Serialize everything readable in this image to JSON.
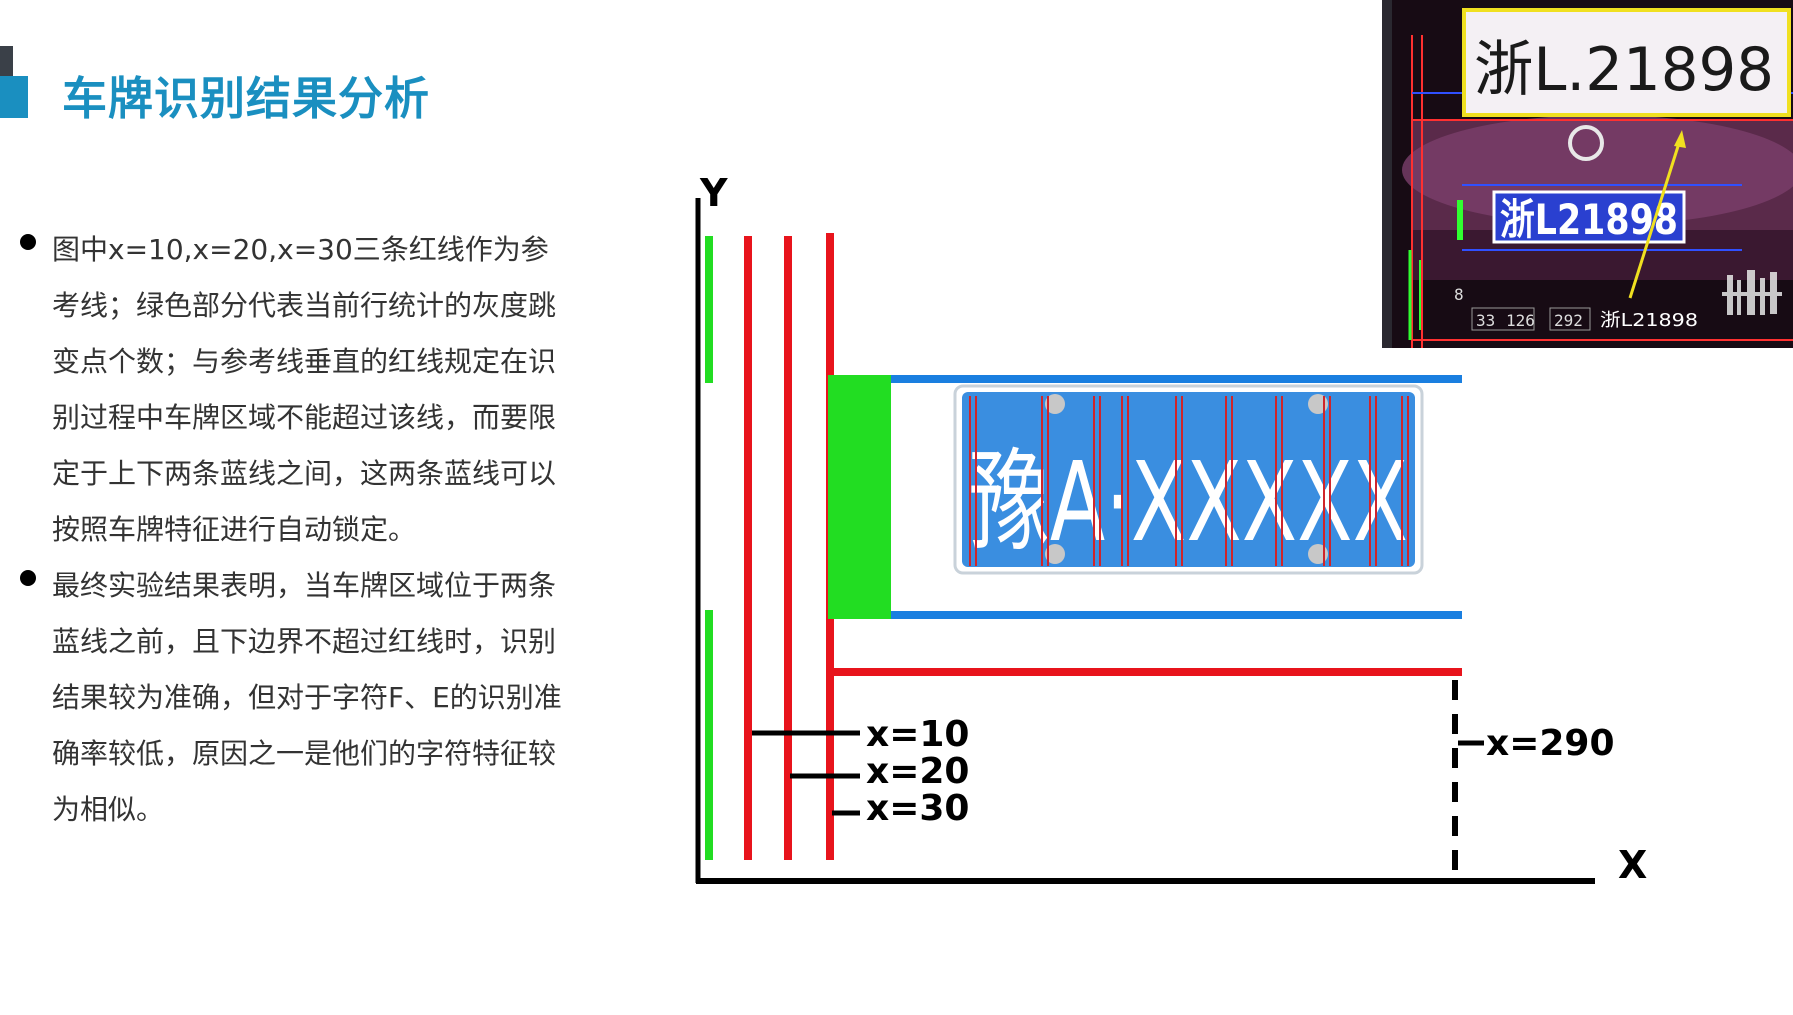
{
  "title": "车牌识别结果分析",
  "bullets": [
    {
      "text": "图中x=10,x=20,x=30三条红线作为参考线；绿色部分代表当前行统计的灰度跳变点个数；与参考线垂直的红线规定在识别过程中车牌区域不能超过该线，而要限定于上下两条蓝线之间，这两条蓝线可以按照车牌特征进行自动锁定。"
    },
    {
      "text": "最终实验结果表明，当车牌区域位于两条蓝线之前，且下边界不超过红线时，识别结果较为准确，但对于字符F、E的识别准确率较低，原因之一是他们的字符特征较为相似。"
    }
  ],
  "diagram": {
    "y_axis_label": "Y",
    "x_axis_label": "X",
    "reference_lines": [
      "x=10",
      "x=20",
      "x=30"
    ],
    "limit_line": "x=290",
    "plate_text": "豫A·XXXXX",
    "colors": {
      "red": "#e8141c",
      "green": "#22dd22",
      "blue": "#1a7fe0",
      "plate_blue": "#3a8ee0"
    }
  },
  "photo": {
    "recognized_text": "浙L.21898",
    "plate_text": "浙L21898",
    "bottom_values": [
      "8",
      "33",
      "126",
      "292"
    ],
    "bottom_plate": "浙L21898",
    "highlight_color": "#f0e020"
  }
}
